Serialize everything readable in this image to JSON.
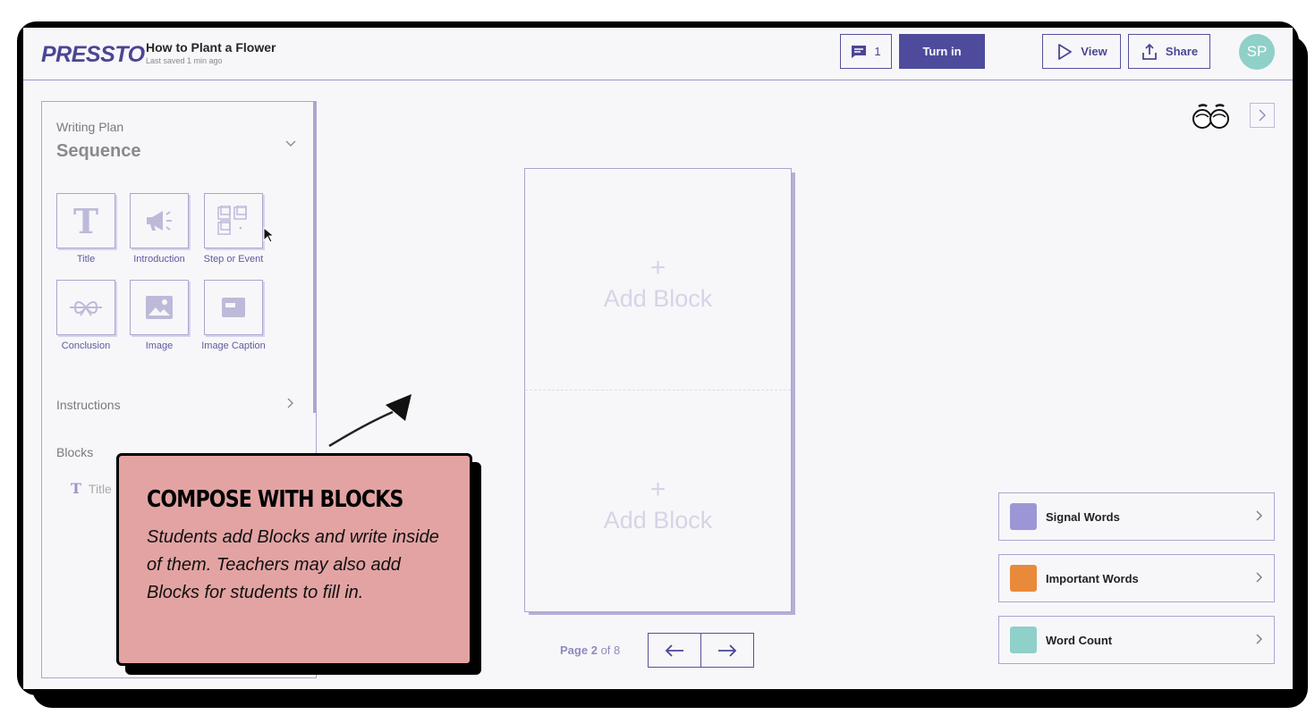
{
  "header": {
    "logo": "PRESSTO",
    "title": "How to Plant a Flower",
    "subtitle": "Last saved 1 min ago",
    "comments_count": "1",
    "turn_in_label": "Turn in",
    "view_label": "View",
    "share_label": "Share",
    "avatar_initials": "SP"
  },
  "panel": {
    "writing_plan_label": "Writing Plan",
    "writing_plan_value": "Sequence",
    "tiles": [
      {
        "label": "Title",
        "icon": "title-icon"
      },
      {
        "label": "Introduction",
        "icon": "megaphone-icon"
      },
      {
        "label": "Step or Event",
        "icon": "steps-icon"
      },
      {
        "label": "Conclusion",
        "icon": "ribbon-icon"
      },
      {
        "label": "Image",
        "icon": "image-icon"
      },
      {
        "label": "Image Caption",
        "icon": "caption-icon"
      }
    ],
    "instructions_label": "Instructions",
    "blocks_label": "Blocks",
    "block_items": [
      "Title"
    ]
  },
  "callout": {
    "title": "COMPOSE WITH BLOCKS",
    "body": "Students add Blocks and write inside of them. Teachers may also add Blocks for students to fill in."
  },
  "canvas": {
    "add_block_top": "Add Block",
    "add_block_bottom": "Add Block",
    "plus": "+",
    "page_label": "Page",
    "page_current": "2",
    "page_of": "of 8"
  },
  "tools": [
    {
      "label": "Signal Words",
      "icon": "signal-words-icon",
      "color": "#9b97d6"
    },
    {
      "label": "Important Words",
      "icon": "important-words-icon",
      "color": "#e88a3a"
    },
    {
      "label": "Word Count",
      "icon": "word-count-icon",
      "color": "#8fd0c8"
    }
  ],
  "colors": {
    "accent": "#4f4b9c",
    "callout": "#e3a3a3",
    "avatar": "#8fd0c8"
  }
}
